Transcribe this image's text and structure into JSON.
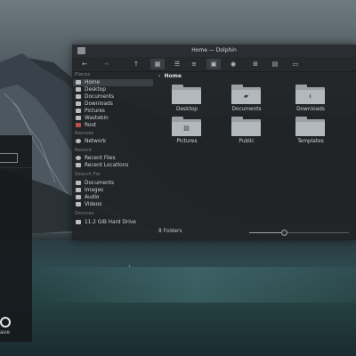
{
  "window": {
    "title": "Home — Dolphin"
  },
  "toolbar": {
    "buttons": [
      {
        "name": "back",
        "glyph": "←"
      },
      {
        "name": "forward",
        "glyph": "→"
      },
      {
        "name": "up",
        "glyph": "↑"
      },
      {
        "name": "icons-view",
        "glyph": "▦"
      },
      {
        "name": "compact-view",
        "glyph": "☰"
      },
      {
        "name": "details-view",
        "glyph": "≡"
      },
      {
        "name": "split",
        "glyph": "▣"
      },
      {
        "name": "preview",
        "glyph": "◉"
      },
      {
        "name": "new-tab",
        "glyph": "⊞"
      },
      {
        "name": "new-folder",
        "glyph": "▤"
      },
      {
        "name": "terminal",
        "glyph": "▭"
      }
    ]
  },
  "sidebar": {
    "places_header": "Places",
    "places": [
      "Home",
      "Desktop",
      "Documents",
      "Downloads",
      "Pictures",
      "Wastebin",
      "Root"
    ],
    "remote_header": "Remote",
    "remote": [
      "Network"
    ],
    "recent_header": "Recent",
    "recent": [
      "Recent Files",
      "Recent Locations"
    ],
    "search_header": "Search For",
    "search": [
      "Documents",
      "Images",
      "Audio",
      "Videos"
    ],
    "devices_header": "Devices",
    "devices": [
      "11.2 GiB Hard Drive"
    ]
  },
  "content": {
    "breadcrumb": "Home",
    "folders": [
      {
        "label": "Desktop",
        "glyph": ""
      },
      {
        "label": "Documents",
        "glyph": "▰"
      },
      {
        "label": "Downloads",
        "glyph": "⭳"
      },
      {
        "label": "Pictures",
        "glyph": "▨"
      },
      {
        "label": "Public",
        "glyph": ""
      },
      {
        "label": "Templates",
        "glyph": ""
      }
    ]
  },
  "status": {
    "text": "8 Folders",
    "zoom": 0.35
  },
  "left_panel": {
    "label": "ave"
  }
}
